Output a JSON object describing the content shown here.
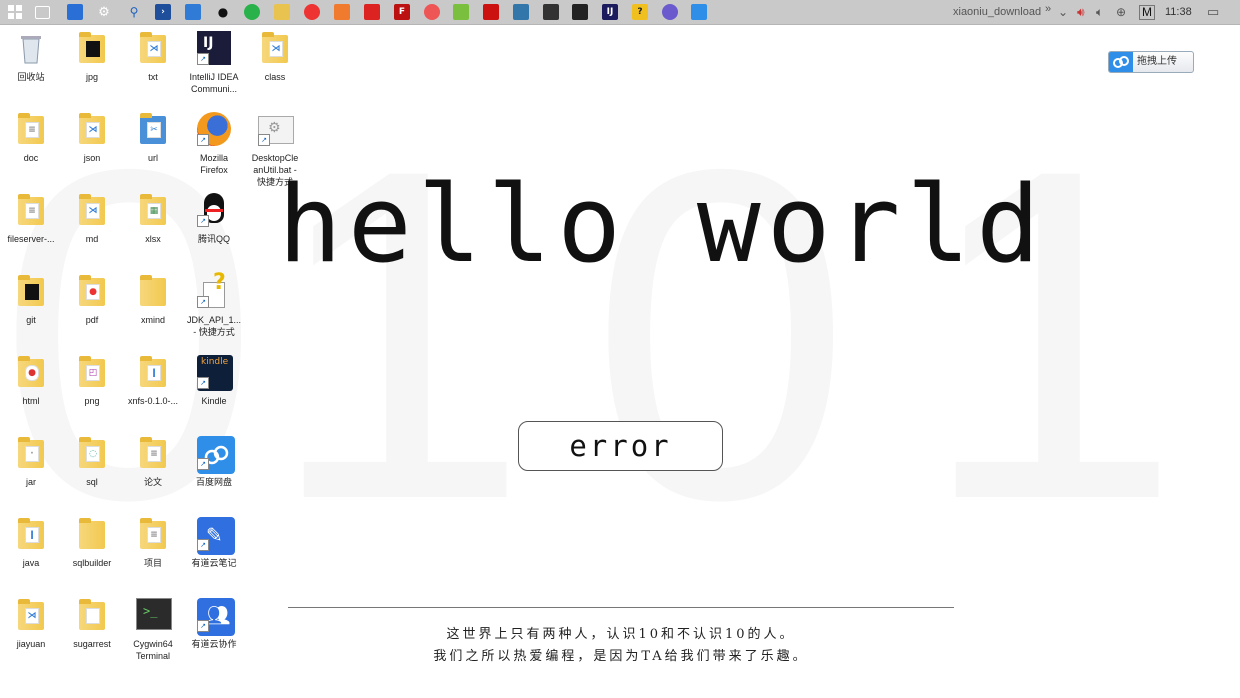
{
  "taskbar": {
    "user": "xiaoniu_download",
    "overflow": "»",
    "ime": "M",
    "time": "11:38"
  },
  "desktop": {
    "icons": [
      {
        "label": "回收站"
      },
      {
        "label": "jpg"
      },
      {
        "label": "txt"
      },
      {
        "label": "IntelliJ IDEA\nCommuni..."
      },
      {
        "label": "class"
      },
      {
        "label": "doc"
      },
      {
        "label": "json"
      },
      {
        "label": "url"
      },
      {
        "label": "Mozilla\nFirefox"
      },
      {
        "label": "DesktopCle\nanUtil.bat -\n快捷方式"
      },
      {
        "label": "fileserver-..."
      },
      {
        "label": "md"
      },
      {
        "label": "xlsx"
      },
      {
        "label": "腾讯QQ"
      },
      {
        "label": "git"
      },
      {
        "label": "pdf"
      },
      {
        "label": "xmind"
      },
      {
        "label": "JDK_API_1...\n- 快捷方式"
      },
      {
        "label": "html"
      },
      {
        "label": "png"
      },
      {
        "label": "xnfs-0.1.0-..."
      },
      {
        "label": "Kindle"
      },
      {
        "label": "jar"
      },
      {
        "label": "sql"
      },
      {
        "label": "论文"
      },
      {
        "label": "百度网盘"
      },
      {
        "label": "java"
      },
      {
        "label": "sqlbuilder"
      },
      {
        "label": "项目"
      },
      {
        "label": "有道云笔记"
      },
      {
        "label": "jiayuan"
      },
      {
        "label": "sugarrest"
      },
      {
        "label": "Cygwin64\nTerminal"
      },
      {
        "label": "有道云协作"
      }
    ]
  },
  "main": {
    "headline": "hello world",
    "button": "error",
    "quote_line1": "这世界上只有两种人，认识10和不认识10的人。",
    "quote_line2": "我们之所以热爱编程，是因为TA给我们带来了乐趣。",
    "wallpaper_digits": [
      "0",
      "1",
      "0",
      "1"
    ]
  },
  "upload_widget": {
    "label": "拖拽上传"
  }
}
